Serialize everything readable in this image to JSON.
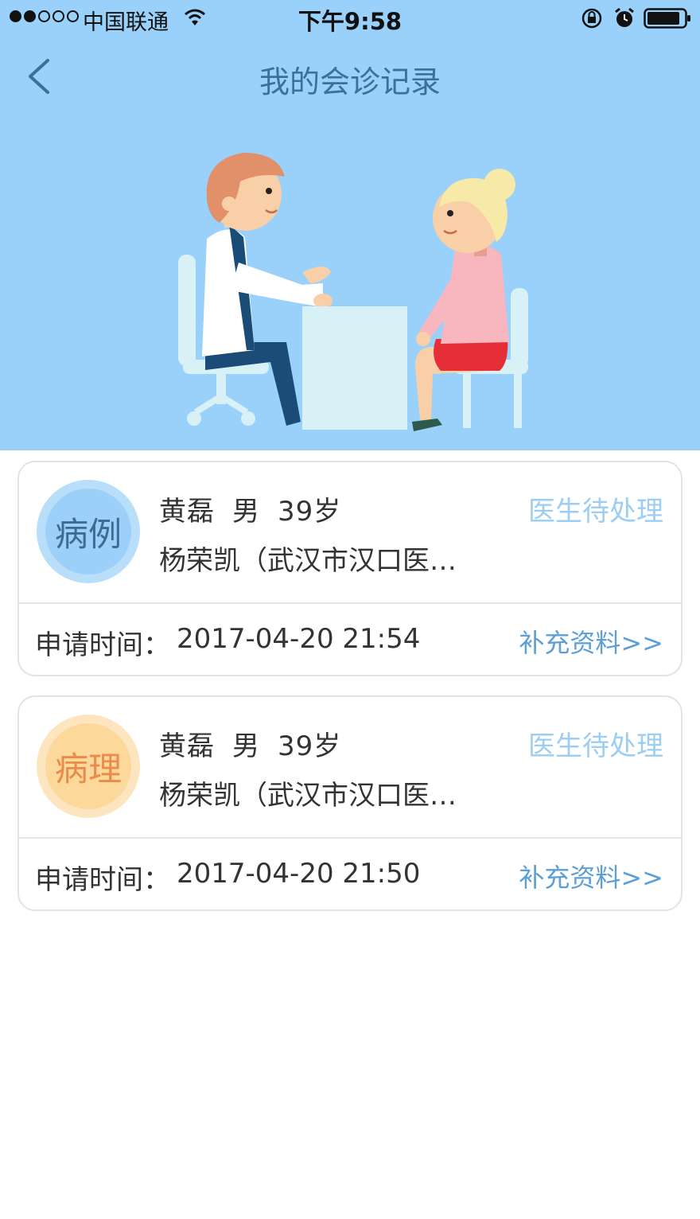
{
  "status_bar": {
    "carrier": "中国联通",
    "time": "下午9:58"
  },
  "nav": {
    "title": "我的会诊记录"
  },
  "records": [
    {
      "type_label": "病例",
      "type_color": "#9cd0f8",
      "name": "黄磊",
      "gender": "男",
      "age": "39岁",
      "doctor": "杨荣凯（武汉市汉口医…",
      "status": "医生待处理",
      "time_label": "申请时间：",
      "time": "2017-04-20 21:54",
      "action": "补充资料>>"
    },
    {
      "type_label": "病理",
      "type_color": "#fcd99a",
      "name": "黄磊",
      "gender": "男",
      "age": "39岁",
      "doctor": "杨荣凯（武汉市汉口医…",
      "status": "医生待处理",
      "time_label": "申请时间：",
      "time": "2017-04-20 21:50",
      "action": "补充资料>>"
    }
  ],
  "colors": {
    "header_bg": "#99d1fa",
    "status_text": "#9ccdf2",
    "link": "#5b9fd6"
  }
}
